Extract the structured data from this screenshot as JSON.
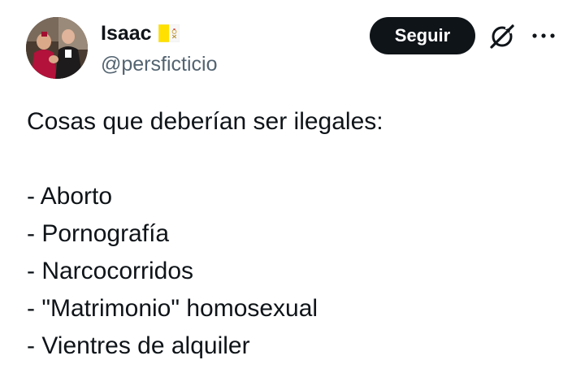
{
  "user": {
    "display_name": "Isaac",
    "handle": "@persficticio",
    "flag_icon": "vatican-flag-icon",
    "avatar_icon": "profile-photo"
  },
  "actions": {
    "follow_label": "Seguir",
    "grok_icon": "grok-icon",
    "more_icon": "more-options-icon"
  },
  "tweet": {
    "lines": [
      "Cosas que deberían ser ilegales:",
      "",
      "- Aborto",
      "- Pornografía",
      "- Narcocorridos",
      "- \"Matrimonio\" homosexual",
      "- Vientres de alquiler"
    ]
  },
  "colors": {
    "text": "#0f1419",
    "secondary": "#536471",
    "button_bg": "#0f1419",
    "button_text": "#ffffff",
    "flag_yellow": "#ffe000"
  }
}
